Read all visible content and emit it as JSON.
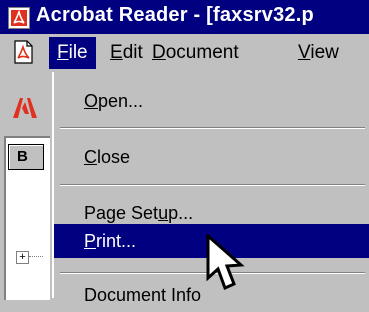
{
  "window": {
    "title": "Acrobat Reader - [faxsrv32.p"
  },
  "menubar": {
    "items": [
      {
        "label_mnemonic": "F",
        "label_rest": "ile"
      },
      {
        "label_mnemonic": "E",
        "label_rest": "dit"
      },
      {
        "label_mnemonic": "D",
        "label_rest": "ocument"
      },
      {
        "label_mnemonic": "V",
        "label_rest": "iew"
      }
    ]
  },
  "sidebar": {
    "tab_label": "B"
  },
  "file_menu": {
    "items": [
      {
        "pre": "",
        "mnemonic": "O",
        "post": "pen..."
      },
      {
        "pre": "",
        "mnemonic": "C",
        "post": "lose"
      },
      {
        "pre": "Page Set",
        "mnemonic": "u",
        "post": "p..."
      },
      {
        "pre": "",
        "mnemonic": "P",
        "post": "rint..."
      },
      {
        "pre": "Document Info",
        "mnemonic": "",
        "post": ""
      }
    ],
    "highlighted_index": 3
  },
  "colors": {
    "highlight": "#000080",
    "face": "#c0c0c0",
    "acrobat_red": "#e0301e"
  },
  "icons": {
    "app": "acrobat-app-icon",
    "document": "pdf-document-icon",
    "logo": "adobe-logo-icon",
    "cursor": "arrow-cursor-icon"
  }
}
